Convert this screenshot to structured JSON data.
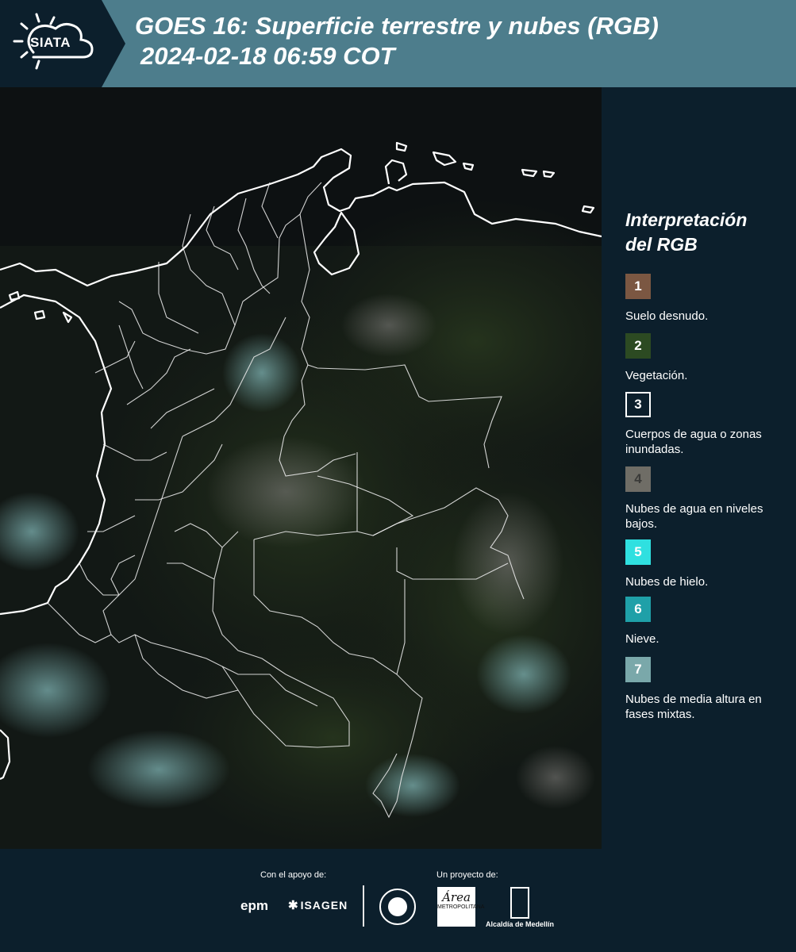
{
  "header": {
    "logo_text": "SIATA",
    "title_line1": "GOES 16: Superficie terrestre y nubes (RGB)",
    "title_line2": "2024-02-18 06:59 COT"
  },
  "legend": {
    "title_line1": "Interpretación",
    "title_line2": "del RGB",
    "items": [
      {
        "number": "1",
        "label": "Suelo desnudo.",
        "color": "#7b5742"
      },
      {
        "number": "2",
        "label": "Vegetación.",
        "color": "#2c4a22"
      },
      {
        "number": "3",
        "label": "Cuerpos de agua o zonas inundadas.",
        "color": "#0c1f2c"
      },
      {
        "number": "4",
        "label": "Nubes de agua en niveles bajos.",
        "color": "#6f6d66"
      },
      {
        "number": "5",
        "label": "Nubes de hielo.",
        "color": "#2fe0e0"
      },
      {
        "number": "6",
        "label": "Nieve.",
        "color": "#1fa0a8"
      },
      {
        "number": "7",
        "label": "Nubes de media altura en fases mixtas.",
        "color": "#7aa8aa"
      }
    ]
  },
  "footer": {
    "support_label": "Con el apoyo de:",
    "project_label": "Un proyecto de:",
    "sponsor_epm": "epm",
    "sponsor_isagen": "ISAGEN",
    "area_logo_text": "Área",
    "area_logo_sub": "METROPOLITANA",
    "alcaldia_label": "Alcaldía de Medellín"
  }
}
